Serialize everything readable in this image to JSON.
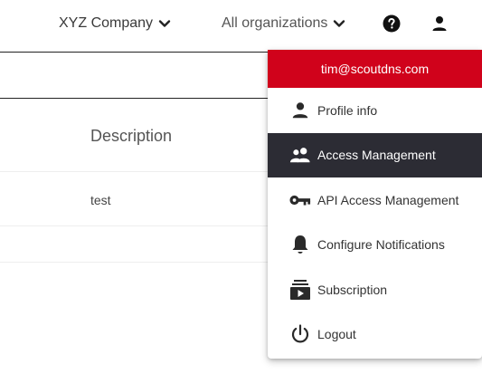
{
  "header": {
    "company": "XYZ Company",
    "organization": "All organizations"
  },
  "table": {
    "description_header": "Description",
    "rows": [
      {
        "description": "test"
      }
    ]
  },
  "user_menu": {
    "email": "tim@scoutdns.com",
    "items": [
      {
        "label": "Profile info",
        "icon": "person-icon"
      },
      {
        "label": "Access Management",
        "icon": "people-icon",
        "active": true
      },
      {
        "label": "API Access Management",
        "icon": "key-icon"
      },
      {
        "label": "Configure Notifications",
        "icon": "bell-icon"
      },
      {
        "label": "Subscription",
        "icon": "subscriptions-icon"
      },
      {
        "label": "Logout",
        "icon": "power-icon"
      }
    ]
  },
  "colors": {
    "menu_header_bg": "#d0021b",
    "active_item_bg": "#2c2c34"
  }
}
